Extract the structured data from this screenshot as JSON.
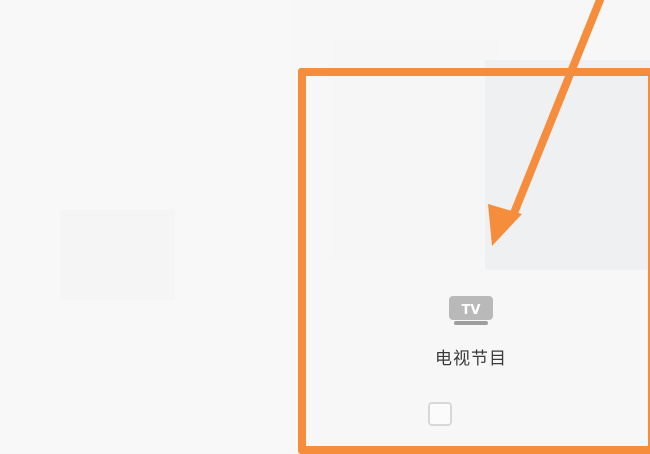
{
  "tile": {
    "label": "电视节目",
    "icon_text": "TV",
    "icon_name": "tv-icon"
  },
  "annotation": {
    "accent_color": "#f58d3d"
  }
}
